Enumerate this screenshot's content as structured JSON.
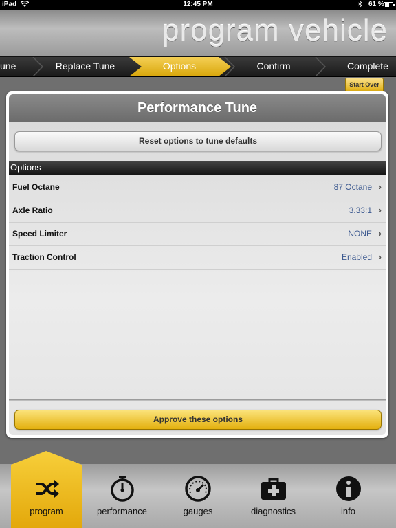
{
  "status_bar": {
    "carrier": "iPad",
    "time": "12:45 PM",
    "battery": "61 %"
  },
  "header": {
    "title": "program vehicle"
  },
  "breadcrumb": {
    "items": [
      {
        "label": "une"
      },
      {
        "label": "Replace Tune"
      },
      {
        "label": "Options"
      },
      {
        "label": "Confirm"
      },
      {
        "label": "Complete"
      }
    ],
    "active_index": 2
  },
  "start_over_label": "Start Over",
  "panel": {
    "title": "Performance Tune",
    "reset_label": "Reset options to tune defaults",
    "options_header": "Options",
    "rows": [
      {
        "label": "Fuel Octane",
        "value": "87 Octane"
      },
      {
        "label": "Axle Ratio",
        "value": "3.33:1"
      },
      {
        "label": "Speed Limiter",
        "value": "NONE"
      },
      {
        "label": "Traction Control",
        "value": "Enabled"
      }
    ],
    "approve_label": "Approve these options"
  },
  "tabs": [
    {
      "label": "program",
      "icon": "shuffle-icon"
    },
    {
      "label": "performance",
      "icon": "stopwatch-icon"
    },
    {
      "label": "gauges",
      "icon": "gauge-icon"
    },
    {
      "label": "diagnostics",
      "icon": "first-aid-kit-icon"
    },
    {
      "label": "info",
      "icon": "info-icon"
    }
  ],
  "colors": {
    "accent": "#e8b41a",
    "value_text": "#3d5a90"
  }
}
